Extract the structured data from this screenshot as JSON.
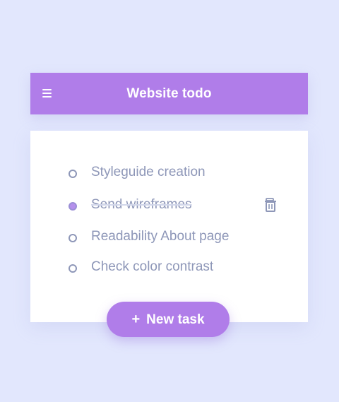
{
  "header": {
    "title": "Website todo",
    "menu_icon": "hamburger-menu-icon"
  },
  "tasks": [
    {
      "label": "Styleguide creation",
      "completed": false
    },
    {
      "label": "Send wireframes",
      "completed": true,
      "delete_icon": "trash-icon"
    },
    {
      "label": "Readability About page",
      "completed": false
    },
    {
      "label": "Check color contrast",
      "completed": false
    }
  ],
  "new_task_button": {
    "icon": "+",
    "label": "New task"
  },
  "colors": {
    "background": "#e2e7fd",
    "accent": "#b07de9",
    "card": "#ffffff",
    "text": "#8e97b8",
    "completed_dot": "#b590ec"
  }
}
